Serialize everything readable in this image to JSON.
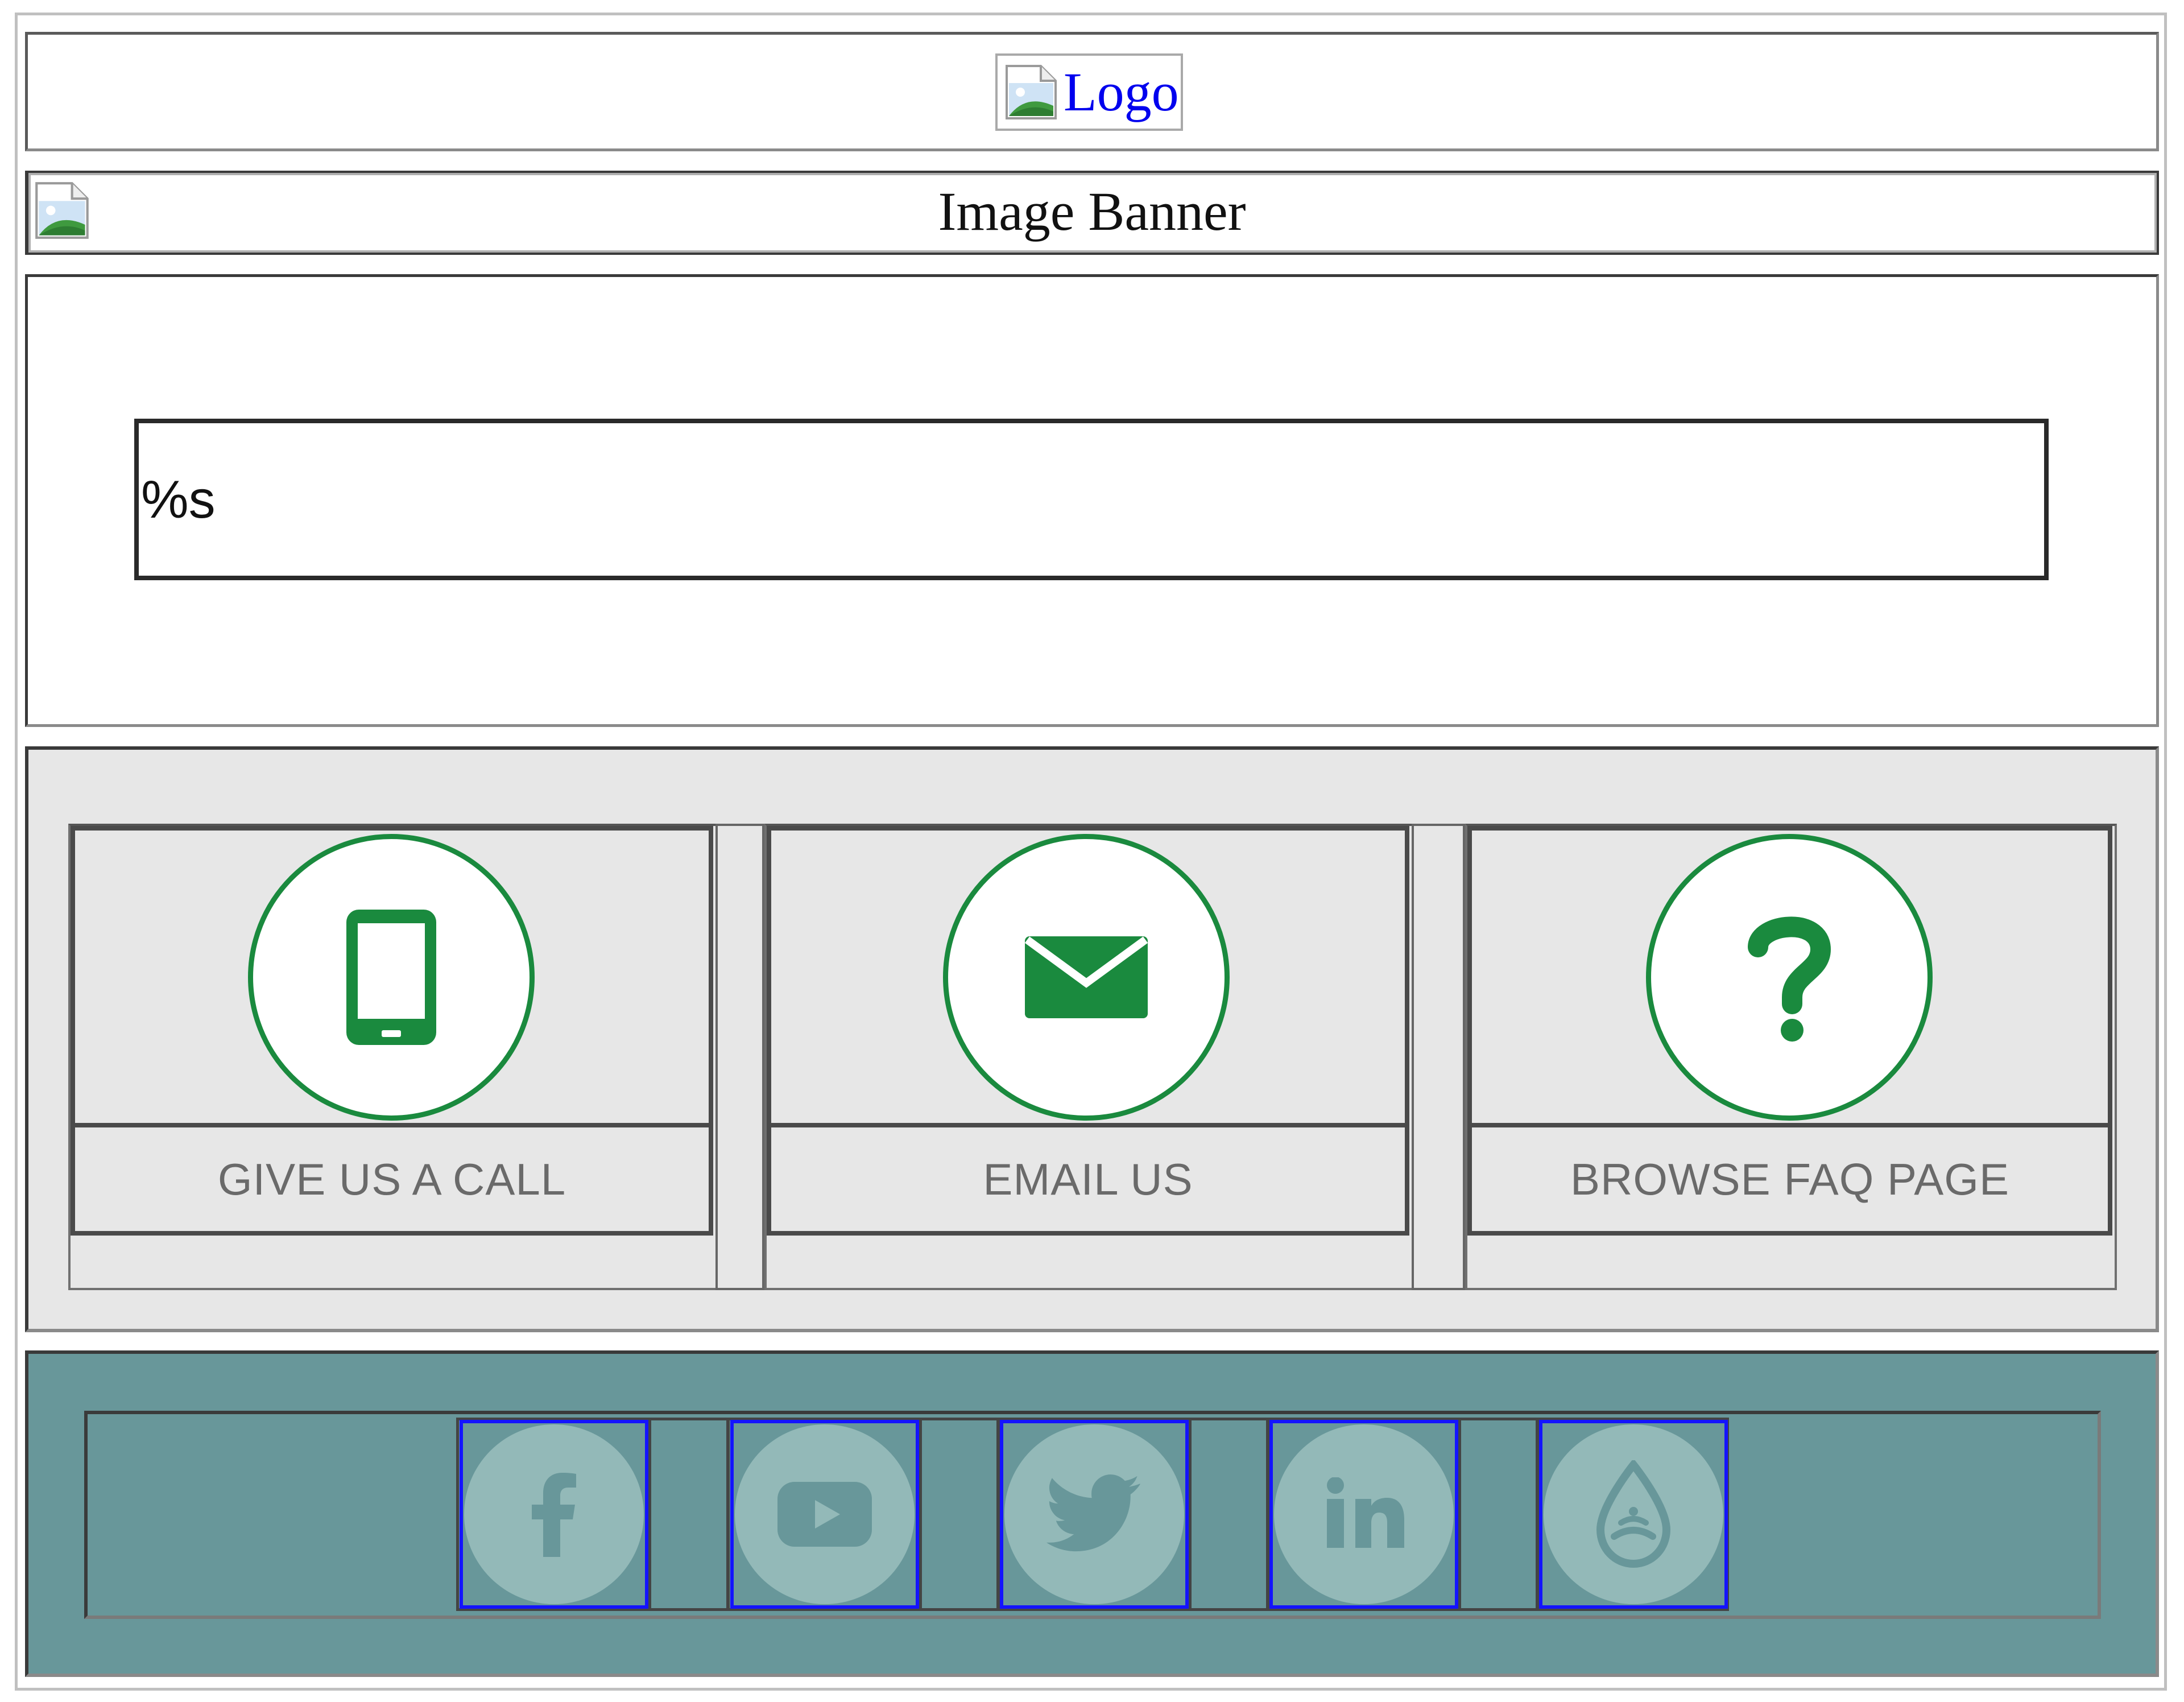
{
  "header": {
    "logo_alt": "Logo"
  },
  "banner": {
    "alt_text": "Image Banner"
  },
  "content": {
    "message": "%s"
  },
  "contact": {
    "cards": [
      {
        "label": "GIVE US A CALL",
        "icon": "phone-icon"
      },
      {
        "label": "EMAIL US",
        "icon": "envelope-icon"
      },
      {
        "label": "BROWSE FAQ PAGE",
        "icon": "question-icon"
      }
    ],
    "accent_color": "#1a8a3e"
  },
  "footer": {
    "background_color": "#68979a",
    "social": [
      {
        "icon": "facebook-icon"
      },
      {
        "icon": "youtube-icon"
      },
      {
        "icon": "twitter-icon"
      },
      {
        "icon": "linkedin-icon"
      },
      {
        "icon": "water-drop-icon"
      }
    ]
  }
}
